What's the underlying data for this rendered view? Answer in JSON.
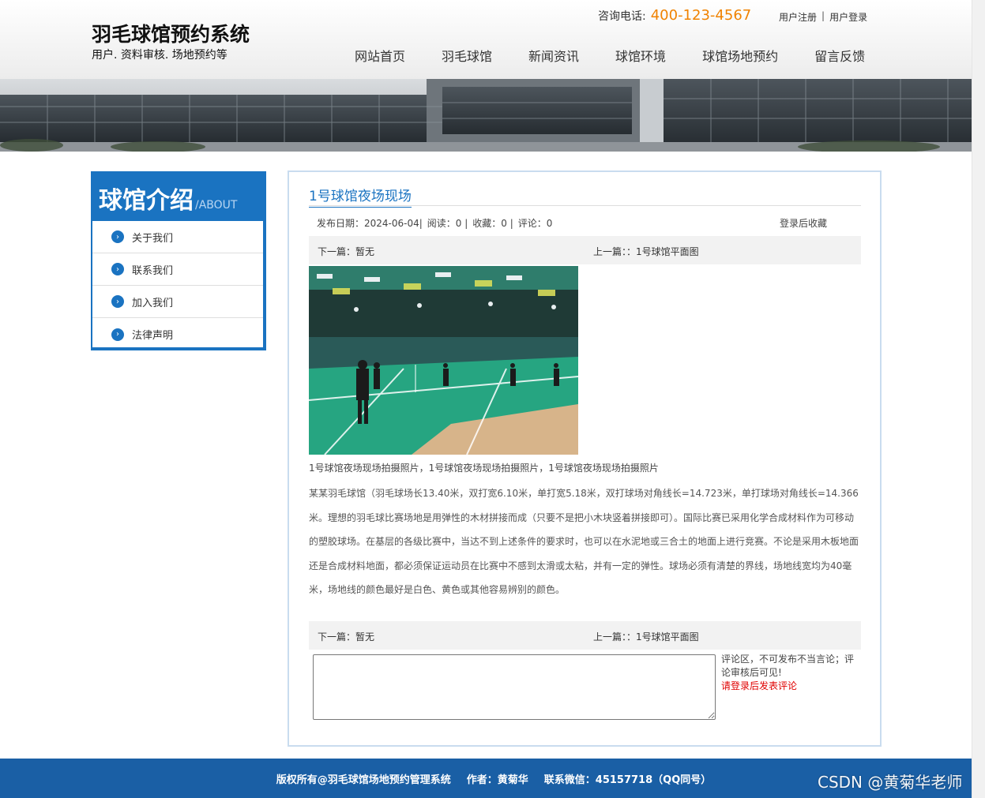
{
  "header": {
    "site_title": "羽毛球馆预约系统",
    "site_subtitle": "用户. 资料审核. 场地预约等",
    "hotline_label": "咨询电话:",
    "hotline_number": "400-123-4567",
    "register_link": "用户注册",
    "separator": "|",
    "login_link": "用户登录"
  },
  "nav": {
    "items": [
      {
        "label": "网站首页"
      },
      {
        "label": "羽毛球馆"
      },
      {
        "label": "新闻资讯"
      },
      {
        "label": "球馆环境"
      },
      {
        "label": "球馆场地预约"
      },
      {
        "label": "留言反馈"
      }
    ]
  },
  "sidebar": {
    "title_cn": "球馆介绍",
    "title_en": "/ABOUT",
    "items": [
      {
        "label": "关于我们"
      },
      {
        "label": "联系我们"
      },
      {
        "label": "加入我们"
      },
      {
        "label": "法律声明"
      }
    ]
  },
  "article": {
    "title": "1号球馆夜场现场",
    "publish_date": "发布日期：2024-06-04|",
    "reads": "阅读：0 |",
    "favorites": "收藏：0 |",
    "comments": "评论：0",
    "fav_login": "登录后收藏",
    "next_label": "下一篇：暂无",
    "prev_label": "上一篇：：1号球馆平面图",
    "caption": "1号球馆夜场现场拍摄照片，1号球馆夜场现场拍摄照片，1号球馆夜场现场拍摄照片",
    "body": "某某羽毛球馆（羽毛球场长13.40米，双打宽6.10米，单打宽5.18米，双打球场对角线长=14.723米，单打球场对角线长=14.366米。理想的羽毛球比赛场地是用弹性的木材拼接而成（只要不是把小木块竖着拼接即可）。国际比赛已采用化学合成材料作为可移动的塑胶球场。在基层的各级比赛中，当达不到上述条件的要求时，也可以在水泥地或三合土的地面上进行竞赛。不论是采用木板地面还是合成材料地面，都必须保证运动员在比赛中不感到太滑或太粘，并有一定的弹性。球场必须有清楚的界线，场地线宽均为40毫米，场地线的颜色最好是白色、黄色或其他容易辨别的颜色。",
    "bottom_next_label": "下一篇：暂无",
    "bottom_prev_label": "上一篇：：1号球馆平面图"
  },
  "comment": {
    "note": "评论区，不可发布不当言论；评论审核后可见!",
    "login_prompt": "请登录后发表评论"
  },
  "footer": {
    "copyright": "版权所有@羽毛球馆场地预约管理系统",
    "author": "作者：黄菊华",
    "contact": "联系微信：45157718（QQ同号）"
  },
  "watermark": "CSDN @黄菊华老师",
  "colors": {
    "accent": "#1a73c1",
    "hotline": "#f08200",
    "footer_bg": "#1a5fa5",
    "login_prompt": "#e00000"
  }
}
